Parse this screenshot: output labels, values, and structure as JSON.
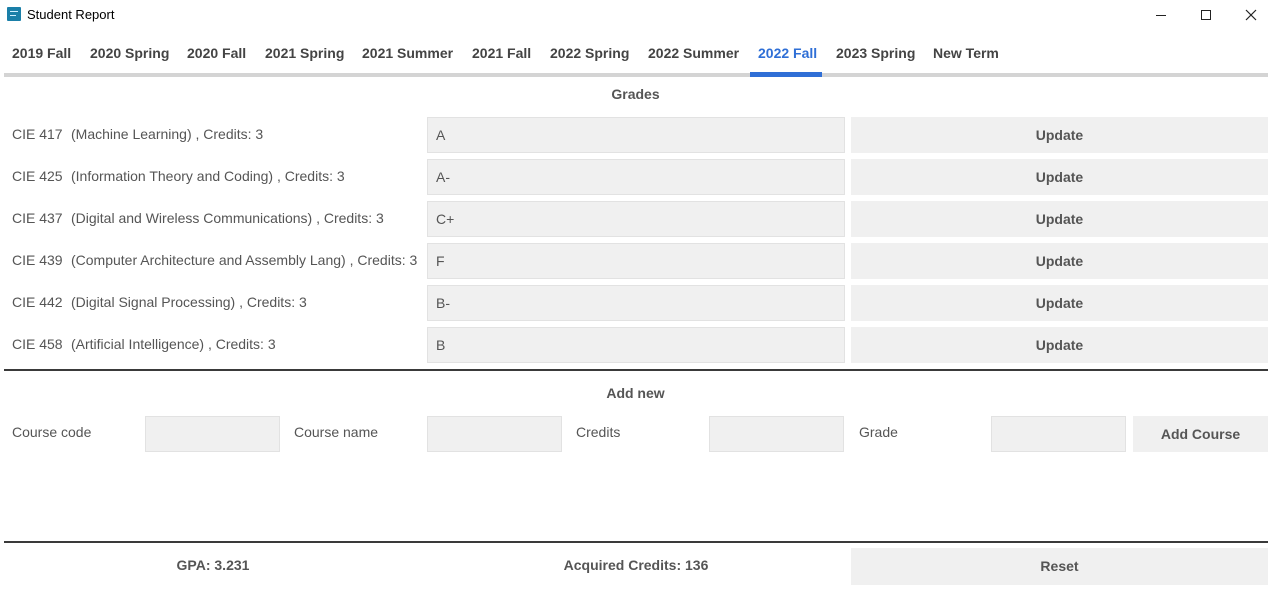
{
  "window": {
    "title": "Student Report",
    "icon": "app-icon"
  },
  "tabs": [
    {
      "label": "2019 Fall",
      "active": false
    },
    {
      "label": "2020 Spring",
      "active": false
    },
    {
      "label": "2020 Fall",
      "active": false
    },
    {
      "label": "2021 Spring",
      "active": false
    },
    {
      "label": "2021 Summer",
      "active": false
    },
    {
      "label": "2021 Fall",
      "active": false
    },
    {
      "label": "2022 Spring",
      "active": false
    },
    {
      "label": "2022 Summer",
      "active": false
    },
    {
      "label": "2022 Fall",
      "active": true
    },
    {
      "label": "2023 Spring",
      "active": false
    },
    {
      "label": "New Term",
      "active": false
    }
  ],
  "accent_color": "#2f6fd6",
  "grades_section": {
    "title": "Grades",
    "courses": [
      {
        "code": "CIE 417",
        "details": "(Machine Learning) , Credits: 3",
        "grade": "A",
        "button": "Update"
      },
      {
        "code": "CIE 425",
        "details": "(Information Theory and Coding) , Credits: 3",
        "grade": "A-",
        "button": "Update"
      },
      {
        "code": "CIE 437",
        "details": "(Digital and Wireless Communications) , Credits: 3",
        "grade": "C+",
        "button": "Update"
      },
      {
        "code": "CIE 439",
        "details": "(Computer Architecture and Assembly Lang) , Credits: 3",
        "grade": "F",
        "button": "Update"
      },
      {
        "code": "CIE 442",
        "details": "(Digital Signal Processing) , Credits: 3",
        "grade": "B-",
        "button": "Update"
      },
      {
        "code": "CIE 458",
        "details": "(Artificial Intelligence) , Credits: 3",
        "grade": "B",
        "button": "Update"
      }
    ]
  },
  "add_new": {
    "title": "Add new",
    "course_code_label": "Course code",
    "course_code_value": "",
    "course_name_label": "Course name",
    "course_name_value": "",
    "credits_label": "Credits",
    "credits_value": "",
    "grade_label": "Grade",
    "grade_value": "",
    "add_button": "Add Course"
  },
  "footer": {
    "gpa": "GPA: 3.231",
    "acquired_credits": "Acquired Credits: 136",
    "reset_button": "Reset"
  }
}
